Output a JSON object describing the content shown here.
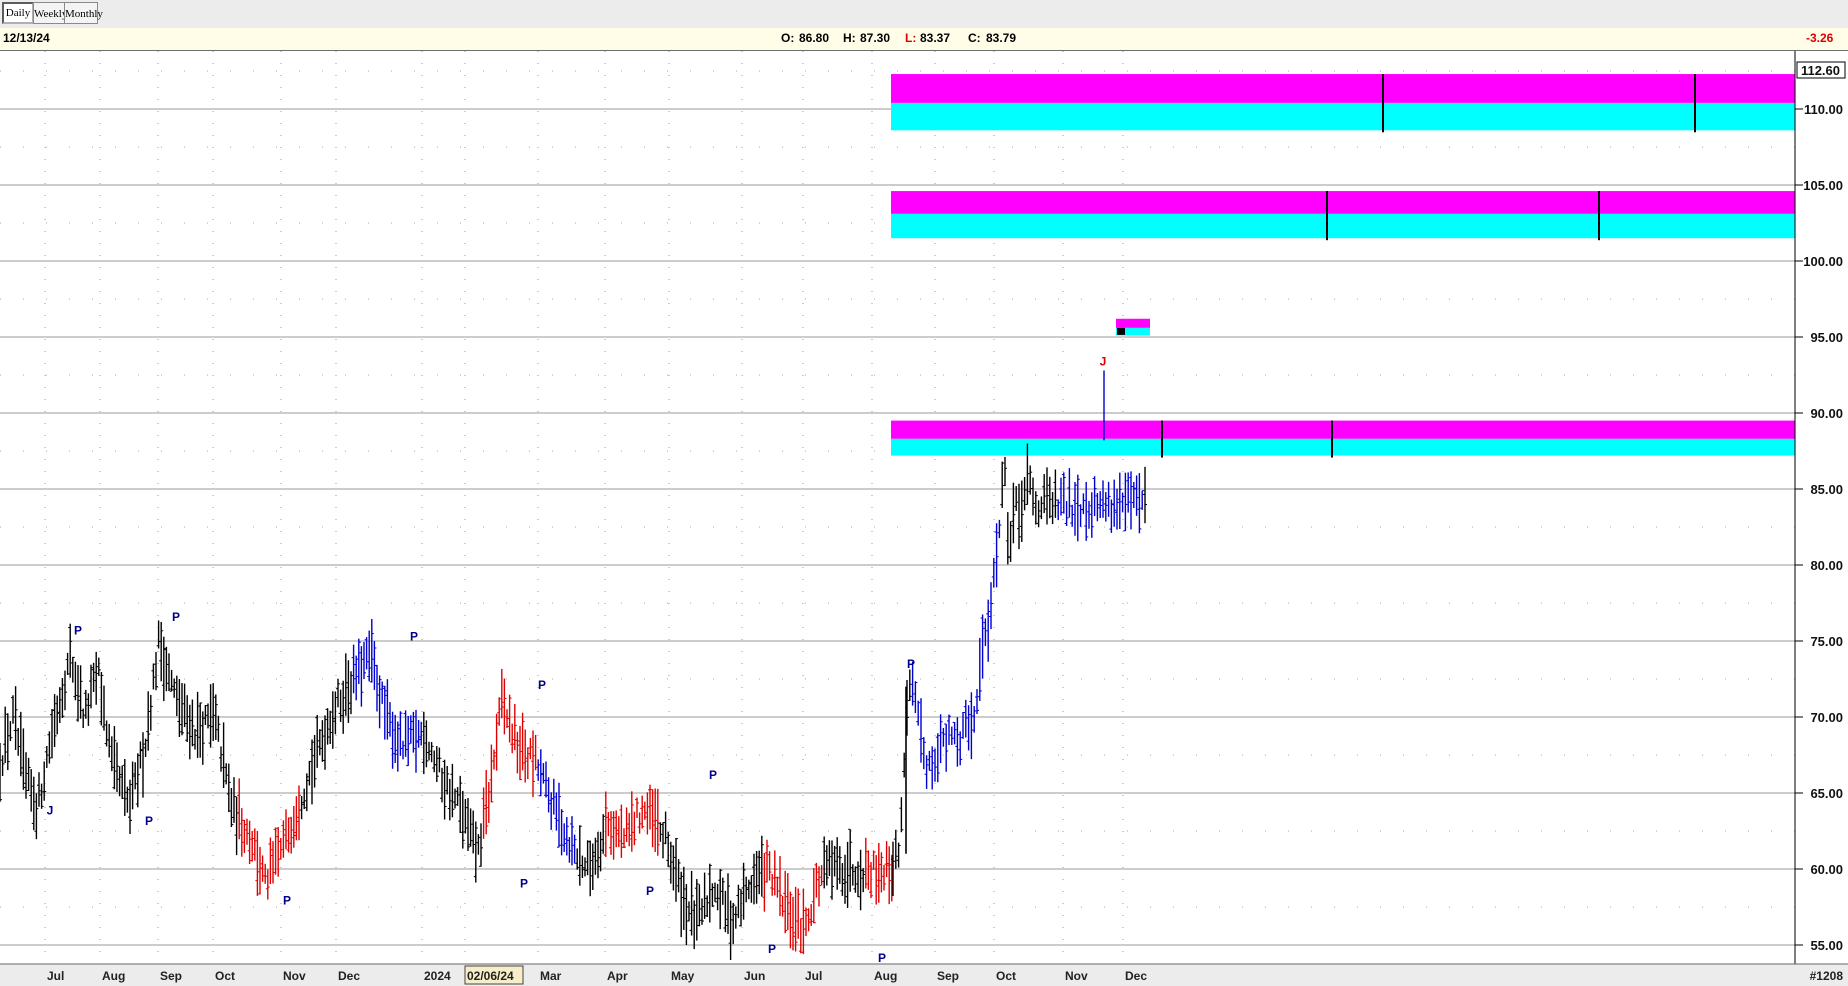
{
  "toolbar": {
    "buttons": [
      {
        "label": "Daily",
        "active": true
      },
      {
        "label": "Weekly",
        "active": false
      },
      {
        "label": "Monthly",
        "active": false
      }
    ]
  },
  "header": {
    "date": "12/13/24",
    "open_label": "O:",
    "open": "86.80",
    "high_label": "H:",
    "high": "87.30",
    "low_label": "L:",
    "low": "83.37",
    "close_label": "C:",
    "close": "83.79",
    "change": "-3.26"
  },
  "footer": {
    "id_label": "#1208",
    "highlighted_date": "02/06/24"
  },
  "colors": {
    "up": "#000000",
    "trend_up": "#0000d0",
    "trend_down": "#e00000",
    "band_top": "#ff00ff",
    "band_bottom": "#00ffff",
    "pivot_text": "#00008b",
    "change": "#e00000"
  },
  "chart_data": {
    "type": "ohlc",
    "ylim": [
      54.5,
      113.3
    ],
    "grid": true,
    "y_ticks": [
      {
        "value": 110,
        "label": "110.00"
      },
      {
        "value": 105,
        "label": "105.00"
      },
      {
        "value": 100,
        "label": "100.00"
      },
      {
        "value": 95,
        "label": "95.00"
      },
      {
        "value": 90,
        "label": "90.00"
      },
      {
        "value": 85,
        "label": "85.00"
      },
      {
        "value": 80,
        "label": "80.00"
      },
      {
        "value": 75,
        "label": "75.00"
      },
      {
        "value": 70,
        "label": "70.00"
      },
      {
        "value": 65,
        "label": "65.00"
      },
      {
        "value": 60,
        "label": "60.00"
      },
      {
        "value": 55,
        "label": "55.00"
      }
    ],
    "last_price_label": "112.60",
    "x_labels": [
      "Jul",
      "Aug",
      "Sep",
      "Oct",
      "Nov",
      "Dec",
      "2024",
      "02/06/24",
      "Mar",
      "Apr",
      "May",
      "Jun",
      "Jul",
      "Aug",
      "Sep",
      "Oct",
      "Nov",
      "Dec"
    ],
    "price_path": [
      {
        "t": 0,
        "p": 67
      },
      {
        "t": 0.015,
        "p": 70
      },
      {
        "t": 0.028,
        "p": 66
      },
      {
        "t": 0.042,
        "p": 64
      },
      {
        "t": 0.058,
        "p": 69
      },
      {
        "t": 0.079,
        "p": 74
      },
      {
        "t": 0.095,
        "p": 70
      },
      {
        "t": 0.11,
        "p": 73
      },
      {
        "t": 0.125,
        "p": 67
      },
      {
        "t": 0.145,
        "p": 64
      },
      {
        "t": 0.162,
        "p": 68
      },
      {
        "t": 0.178,
        "p": 75
      },
      {
        "t": 0.198,
        "p": 71
      },
      {
        "t": 0.22,
        "p": 69
      },
      {
        "t": 0.24,
        "p": 70
      },
      {
        "t": 0.26,
        "p": 64
      },
      {
        "t": 0.282,
        "p": 62
      },
      {
        "t": 0.297,
        "p": 59
      },
      {
        "t": 0.32,
        "p": 62
      },
      {
        "t": 0.345,
        "p": 66
      },
      {
        "t": 0.37,
        "p": 70
      },
      {
        "t": 0.39,
        "p": 72
      },
      {
        "t": 0.415,
        "p": 74
      },
      {
        "t": 0.432,
        "p": 70
      },
      {
        "t": 0.45,
        "p": 68
      },
      {
        "t": 0.475,
        "p": 69
      },
      {
        "t": 0.495,
        "p": 66
      },
      {
        "t": 0.515,
        "p": 64
      },
      {
        "t": 0.535,
        "p": 61
      },
      {
        "t": 0.548,
        "p": 65
      },
      {
        "t": 0.562,
        "p": 71
      },
      {
        "t": 0.58,
        "p": 68
      },
      {
        "t": 0.6,
        "p": 67
      },
      {
        "t": 0.62,
        "p": 64
      },
      {
        "t": 0.645,
        "p": 61
      },
      {
        "t": 0.66,
        "p": 60
      },
      {
        "t": 0.68,
        "p": 63
      },
      {
        "t": 0.7,
        "p": 62
      },
      {
        "t": 0.72,
        "p": 64
      },
      {
        "t": 0.745,
        "p": 62
      },
      {
        "t": 0.765,
        "p": 58
      },
      {
        "t": 0.78,
        "p": 56.5
      },
      {
        "t": 0.8,
        "p": 59
      },
      {
        "t": 0.82,
        "p": 56.5
      },
      {
        "t": 0.84,
        "p": 59
      },
      {
        "t": 0.86,
        "p": 60
      },
      {
        "t": 0.875,
        "p": 58
      },
      {
        "t": 0.885,
        "p": 57
      },
      {
        "t": 0.9,
        "p": 56
      },
      {
        "t": 0.915,
        "p": 59
      },
      {
        "t": 0.925,
        "p": 60
      }
    ],
    "price_path_2": [
      {
        "t": 0,
        "p": 60
      },
      {
        "t": 0.03,
        "p": 62
      },
      {
        "t": 0.055,
        "p": 71
      },
      {
        "t": 0.075,
        "p": 72
      },
      {
        "t": 0.105,
        "p": 69
      },
      {
        "t": 0.13,
        "p": 67
      },
      {
        "t": 0.16,
        "p": 67
      },
      {
        "t": 0.185,
        "p": 68.5
      },
      {
        "t": 0.21,
        "p": 68
      },
      {
        "t": 0.235,
        "p": 69
      },
      {
        "t": 0.26,
        "p": 68
      },
      {
        "t": 0.285,
        "p": 70
      },
      {
        "t": 0.31,
        "p": 69
      },
      {
        "t": 0.335,
        "p": 72
      },
      {
        "t": 0.36,
        "p": 75
      },
      {
        "t": 0.385,
        "p": 77
      },
      {
        "t": 0.41,
        "p": 80
      },
      {
        "t": 0.43,
        "p": 85
      },
      {
        "t": 0.445,
        "p": 86
      },
      {
        "t": 0.46,
        "p": 79
      },
      {
        "t": 0.475,
        "p": 83
      },
      {
        "t": 0.49,
        "p": 85
      },
      {
        "t": 0.505,
        "p": 82
      },
      {
        "t": 0.52,
        "p": 84
      },
      {
        "t": 0.535,
        "p": 86
      },
      {
        "t": 0.55,
        "p": 85
      },
      {
        "t": 0.56,
        "p": 84
      }
    ],
    "spike": {
      "low": 88.2,
      "high": 92.8
    },
    "pivots": [
      {
        "label": "J",
        "price": 64.5,
        "kind": "low",
        "color": "#00008b"
      },
      {
        "label": "P",
        "price": 75.3,
        "kind": "high",
        "color": "#00008b"
      },
      {
        "label": "P",
        "price": 63.8,
        "kind": "low",
        "color": "#00008b"
      },
      {
        "label": "P",
        "price": 76.2,
        "kind": "high",
        "color": "#00008b"
      },
      {
        "label": "P",
        "price": 58.6,
        "kind": "low",
        "color": "#00008b"
      },
      {
        "label": "P",
        "price": 74.9,
        "kind": "high",
        "color": "#00008b"
      },
      {
        "label": "P",
        "price": 59.7,
        "kind": "low",
        "color": "#00008b"
      },
      {
        "label": "P",
        "price": 71.7,
        "kind": "high",
        "color": "#00008b"
      },
      {
        "label": "P",
        "price": 59.2,
        "kind": "low",
        "color": "#00008b"
      },
      {
        "label": "P",
        "price": 65.8,
        "kind": "high",
        "color": "#00008b"
      },
      {
        "label": "P",
        "price": 55.4,
        "kind": "low",
        "color": "#00008b"
      },
      {
        "label": "P",
        "price": 54.8,
        "kind": "low",
        "color": "#00008b"
      },
      {
        "label": "P",
        "price": 73.1,
        "kind": "high",
        "color": "#00008b"
      },
      {
        "label": "J",
        "price": 93.0,
        "kind": "high",
        "color": "#e00000"
      }
    ],
    "bands": [
      {
        "top": 112.3,
        "mid": 110.4,
        "bottom": 108.6
      },
      {
        "top": 104.6,
        "mid": 103.1,
        "bottom": 101.5
      },
      {
        "top": 89.5,
        "mid": 88.3,
        "bottom": 87.2
      }
    ],
    "small_band": {
      "top": 96.2,
      "mid": 95.6,
      "bottom": 95.1
    }
  }
}
